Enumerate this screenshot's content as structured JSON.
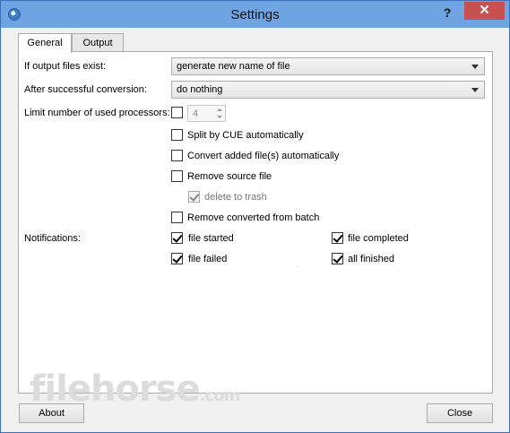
{
  "window": {
    "title": "Settings",
    "help_label": "?",
    "close_label": "✕"
  },
  "tabs": [
    {
      "label": "General"
    },
    {
      "label": "Output"
    }
  ],
  "general": {
    "output_exists_label": "If output files exist:",
    "output_exists_value": "generate new name of file",
    "after_conversion_label": "After successful conversion:",
    "after_conversion_value": "do nothing",
    "limit_processors_label": "Limit number of used processors:",
    "processors_value": "4",
    "split_cue": "Split by CUE automatically",
    "convert_added": "Convert added file(s) automatically",
    "remove_source": "Remove source file",
    "delete_to_trash": "delete to trash",
    "remove_converted": "Remove converted from batch",
    "notifications_label": "Notifications:",
    "file_started": "file started",
    "file_completed": "file completed",
    "file_failed": "file failed",
    "all_finished": "all finished"
  },
  "watermark": {
    "text": "filehorse",
    "suffix": ".com"
  },
  "footer": {
    "about_label": "About",
    "close_label": "Close"
  }
}
